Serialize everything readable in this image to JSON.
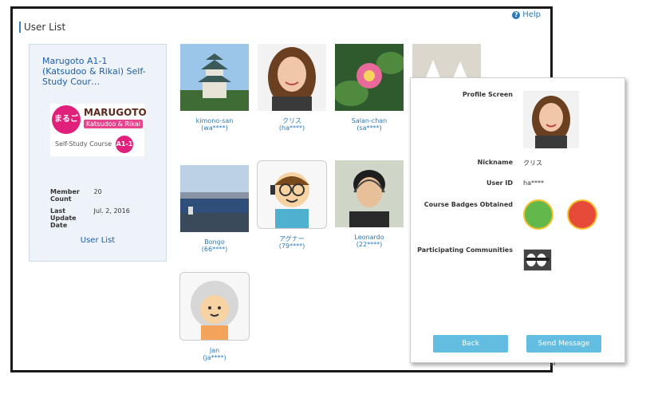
{
  "header": {
    "help_label": "Help",
    "page_title": "User List"
  },
  "course": {
    "title": "Marugoto A1-1 (Katsudoo & Rikai) Self-Study Cour…",
    "logo": {
      "circle_text": "まるごと",
      "word": "MARUGOTO",
      "sub": "Katsudoo & Rikai",
      "caption": "Self-Study Course",
      "level": "A1-1"
    },
    "member_count_label": "Member Count",
    "member_count": "20",
    "last_update_label": "Last Update Date",
    "last_update": "Jul. 2, 2016",
    "user_list_link": "User List"
  },
  "users": [
    {
      "name": "kimono-san",
      "id": "(wa****)"
    },
    {
      "name": "クリス",
      "id": "(ha****)"
    },
    {
      "name": "Salan-chan",
      "id": "(sa****)"
    },
    {
      "name": "Bongo",
      "id": "(66****)"
    },
    {
      "name": "アグナー",
      "id": "(79****)"
    },
    {
      "name": "Leonardo",
      "id": "(22****)"
    },
    {
      "name": "Jan",
      "id": "(ja****)"
    }
  ],
  "profile": {
    "screen_label": "Profile Screen",
    "nickname_label": "Nickname",
    "nickname": "クリス",
    "user_id_label": "User ID",
    "user_id": "ha****",
    "badges_label": "Course Badges Obtained",
    "communities_label": "Participating Communities",
    "back_label": "Back",
    "send_label": "Send Message"
  },
  "colors": {
    "link": "#2a7ab8",
    "accent": "#3c7dc0",
    "button": "#63bde0",
    "brand": "#e0207a"
  },
  "corner_mark": "↵"
}
